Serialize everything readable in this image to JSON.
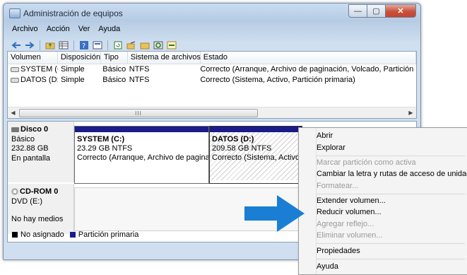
{
  "window": {
    "title": "Administración de equipos",
    "controls": [
      "—",
      "▢",
      "✕"
    ]
  },
  "menubar": [
    "Archivo",
    "Acción",
    "Ver",
    "Ayuda"
  ],
  "toolbar": [
    "back-arrow-icon",
    "forward-arrow-icon",
    "up-folder-icon",
    "grid-icon",
    "help-icon",
    "properties-icon",
    "refresh-icon",
    "export-icon",
    "open-icon",
    "search-icon",
    "connect-icon"
  ],
  "volume_table": {
    "headers": [
      "Volumen",
      "Disposición",
      "Tipo",
      "Sistema de archivos",
      "Estado"
    ],
    "rows": [
      [
        "SYSTEM (C:)",
        "Simple",
        "Básico",
        "NTFS",
        "Correcto (Arranque, Archivo de paginación, Volcado, Partición prima"
      ],
      [
        "DATOS (D:)",
        "Simple",
        "Básico",
        "NTFS",
        "Correcto (Sistema, Activo, Partición primaria)"
      ]
    ],
    "scroll_grip": "III"
  },
  "disks": [
    {
      "name": "Disco 0",
      "type": "Básico",
      "size": "232.88 GB",
      "status": "En pantalla"
    },
    {
      "name": "CD-ROM 0",
      "type": "DVD (E:)",
      "size": "",
      "status": "No hay medios"
    }
  ],
  "partitions": [
    {
      "name": "SYSTEM  (C:)",
      "size": "23.29 GB NTFS",
      "status": "Correcto (Arranque, Archivo de paginaci"
    },
    {
      "name": "DATOS  (D:)",
      "size": "209.58 GB NTFS",
      "status": "Correcto (Sistema, Activo, P"
    }
  ],
  "legend": [
    {
      "label": "No asignado",
      "color": "#000000"
    },
    {
      "label": "Partición primaria",
      "color": "#1b1b8a"
    }
  ],
  "context_menu": {
    "items": [
      {
        "label": "Abrir",
        "enabled": true
      },
      {
        "label": "Explorar",
        "enabled": true
      },
      {
        "label": "Marcar partición como activa",
        "enabled": false
      },
      {
        "label": "Cambiar la letra y rutas de acceso de unidad...",
        "enabled": true
      },
      {
        "label": "Formatear...",
        "enabled": false
      },
      {
        "label": "Extender volumen...",
        "enabled": true
      },
      {
        "label": "Reducir volumen...",
        "enabled": true
      },
      {
        "label": "Agregar reflejo...",
        "enabled": false
      },
      {
        "label": "Eliminar volumen...",
        "enabled": false
      },
      {
        "label": "Propiedades",
        "enabled": true
      },
      {
        "label": "Ayuda",
        "enabled": true
      }
    ]
  },
  "colors": {
    "accent_arrow": "#1a7fd4",
    "primary_partition": "#1b1b8a"
  }
}
